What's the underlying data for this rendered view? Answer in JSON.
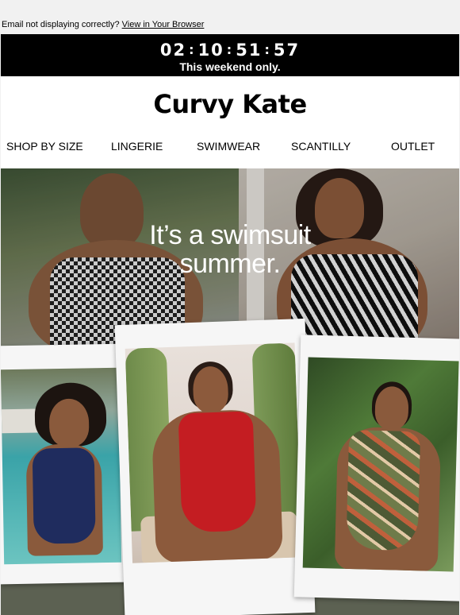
{
  "preheader": {
    "text": "Email not displaying correctly?",
    "link": "View in Your Browser"
  },
  "countdown": {
    "hours": "02",
    "minutes": "10",
    "seconds": "51",
    "frames": "57",
    "separator": ":",
    "subtitle": "This weekend only."
  },
  "brand": {
    "logo": "Curvy Kate"
  },
  "nav": {
    "items": [
      "SHOP BY SIZE",
      "LINGERIE",
      "SWIMWEAR",
      "SCANTILLY",
      "OUTLET"
    ]
  },
  "hero": {
    "headline_line1": "It’s a swimsuit",
    "headline_line2": "summer."
  },
  "colors": {
    "black": "#000000",
    "navy_swimsuit": "#1f2c5e",
    "red_swimsuit": "#c41d22",
    "tropical_swimsuit": "#4e5a35"
  }
}
